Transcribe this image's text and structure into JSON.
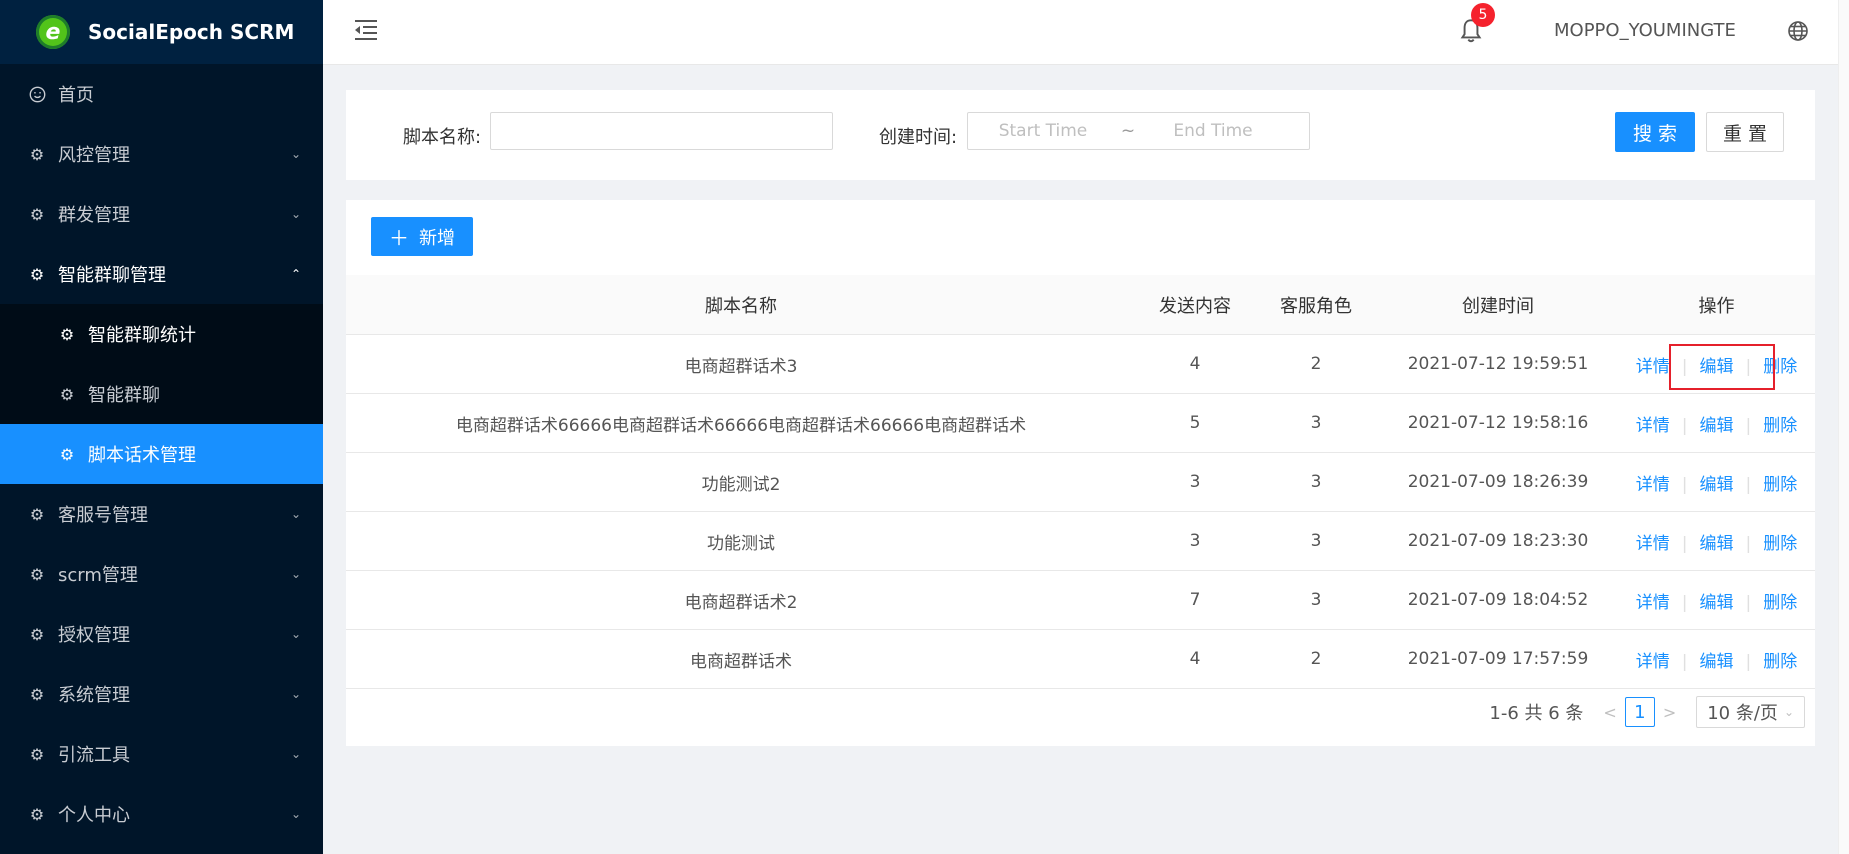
{
  "app": {
    "title": "SocialEpoch SCRM",
    "logo_letter": "e"
  },
  "menu": [
    {
      "label": "首页",
      "icon": "smile-icon"
    },
    {
      "label": "风控管理",
      "icon": "gear-icon"
    },
    {
      "label": "群发管理",
      "icon": "gear-icon"
    },
    {
      "label": "智能群聊管理",
      "icon": "gear-icon",
      "open": true,
      "children": [
        {
          "label": "智能群聊统计",
          "icon": "gear-icon"
        },
        {
          "label": "智能群聊",
          "icon": "gear-icon"
        },
        {
          "label": "脚本话术管理",
          "icon": "gear-icon",
          "active": true
        }
      ]
    },
    {
      "label": "客服号管理",
      "icon": "gear-icon"
    },
    {
      "label": "scrm管理",
      "icon": "gear-icon"
    },
    {
      "label": "授权管理",
      "icon": "gear-icon"
    },
    {
      "label": "系统管理",
      "icon": "gear-icon"
    },
    {
      "label": "引流工具",
      "icon": "gear-icon"
    },
    {
      "label": "个人中心",
      "icon": "gear-icon"
    }
  ],
  "header": {
    "notifications": "5",
    "username": "MOPPO_YOUMINGTE"
  },
  "search": {
    "name_label": "脚本名称:",
    "name_value": "",
    "time_label": "创建时间:",
    "start_placeholder": "Start Time",
    "range_sep": "~",
    "end_placeholder": "End Time",
    "search_btn": "搜 索",
    "reset_btn": "重 置"
  },
  "toolbar": {
    "add_btn": "新增"
  },
  "table": {
    "columns": [
      "脚本名称",
      "发送内容",
      "客服角色",
      "创建时间",
      "操作"
    ],
    "rows": [
      {
        "name": "电商超群话术3",
        "content": "4",
        "role": "2",
        "created": "2021-07-12 19:59:51"
      },
      {
        "name": "电商超群话术66666电商超群话术66666电商超群话术66666电商超群话术",
        "content": "5",
        "role": "3",
        "created": "2021-07-12 19:58:16"
      },
      {
        "name": "功能测试2",
        "content": "3",
        "role": "3",
        "created": "2021-07-09 18:26:39"
      },
      {
        "name": "功能测试",
        "content": "3",
        "role": "3",
        "created": "2021-07-09 18:23:30"
      },
      {
        "name": "电商超群话术2",
        "content": "7",
        "role": "3",
        "created": "2021-07-09 18:04:52"
      },
      {
        "name": "电商超群话术",
        "content": "4",
        "role": "2",
        "created": "2021-07-09 17:57:59"
      }
    ],
    "actions": {
      "detail": "详情",
      "edit": "编辑",
      "delete": "删除"
    }
  },
  "pagination": {
    "summary": "1-6 共 6 条",
    "current": "1",
    "page_size": "10 条/页"
  },
  "colors": {
    "primary": "#1890ff",
    "sidebar": "#001529",
    "highlight": "#e5202b"
  }
}
